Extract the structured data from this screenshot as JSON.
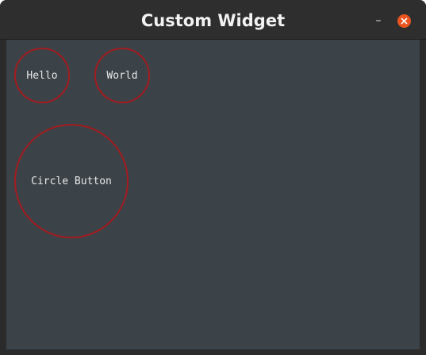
{
  "window": {
    "title": "Custom Widget",
    "minimize_label": "–",
    "close_icon": "close-icon",
    "close_color": "#e9541f"
  },
  "buttons": [
    {
      "label": "Hello"
    },
    {
      "label": "World"
    },
    {
      "label": "Circle Button"
    }
  ],
  "colors": {
    "content_background": "#3b4248",
    "button_border": "#a31c1f",
    "button_text": "#e8e8e8"
  }
}
